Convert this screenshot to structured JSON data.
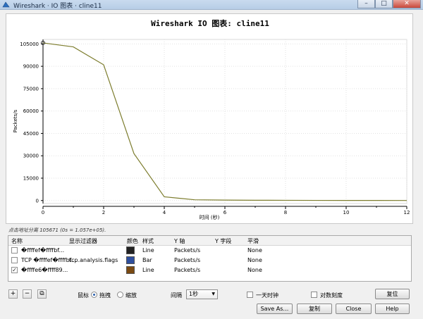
{
  "window": {
    "title": "Wireshark · IO 图表 · cline11",
    "minimize": "–",
    "maximize": "□",
    "close": "✕"
  },
  "chart_data": {
    "type": "line",
    "title": "Wireshark IO 图表: cline11",
    "xlabel": "时间 (秒)",
    "ylabel": "Packets/s",
    "x": [
      0,
      1,
      2,
      3,
      4,
      5,
      6,
      7,
      8,
      9,
      10,
      11,
      12
    ],
    "series": [
      {
        "values": [
          105671,
          103000,
          91000,
          31500,
          2500,
          500,
          300,
          200,
          150,
          100,
          80,
          60,
          40
        ],
        "color": "#7d7d2e"
      }
    ],
    "xlim": [
      0,
      12
    ],
    "ylim": [
      -2000,
      108000
    ],
    "xticks": [
      0,
      2,
      4,
      6,
      8,
      10,
      12
    ],
    "yticks": [
      0,
      15000,
      30000,
      45000,
      60000,
      75000,
      90000,
      105000
    ],
    "grid": true,
    "legend": "none"
  },
  "hint": "点击地址分离 105671 (0s = 1.057e+05).",
  "table": {
    "headers": {
      "name": "名称",
      "filter": "显示过滤器",
      "color": "颜色",
      "style": "样式",
      "y_axis": "Y 轴",
      "y_field": "Y 字段",
      "smoothing": "平滑"
    },
    "rows": [
      {
        "checked": false,
        "check_mark": "",
        "name": "�ffffef�ffffbf...",
        "filter": "",
        "color": "#222222",
        "style": "Line",
        "y_axis": "Packets/s",
        "y_field": "",
        "smoothing": "None"
      },
      {
        "checked": false,
        "check_mark": "",
        "name": "TCP �ffffef�ffffbf...",
        "filter": "tcp.analysis.flags",
        "color": "#2e4f9e",
        "style": "Bar",
        "y_axis": "Packets/s",
        "y_field": "",
        "smoothing": "None"
      },
      {
        "checked": true,
        "check_mark": "✓",
        "name": "�ffffe6�ffff89...",
        "filter": "",
        "color": "#7a4a12",
        "style": "Line",
        "y_axis": "Packets/s",
        "y_field": "",
        "smoothing": "None"
      }
    ]
  },
  "toolbar": {
    "add": "+",
    "remove": "−",
    "copy_graph": "⧉",
    "mouse_label": "鼠标",
    "drag_label": "拖拽",
    "zoom_label": "缩放",
    "interval_label": "间隔",
    "interval_value": "1秒",
    "time_of_day_label": "一天时钟",
    "log_scale_label": "对数刻度",
    "reset_label": "复位"
  },
  "buttons": {
    "save_as": "Save As…",
    "copy": "复制",
    "close": "Close",
    "help": "Help"
  }
}
